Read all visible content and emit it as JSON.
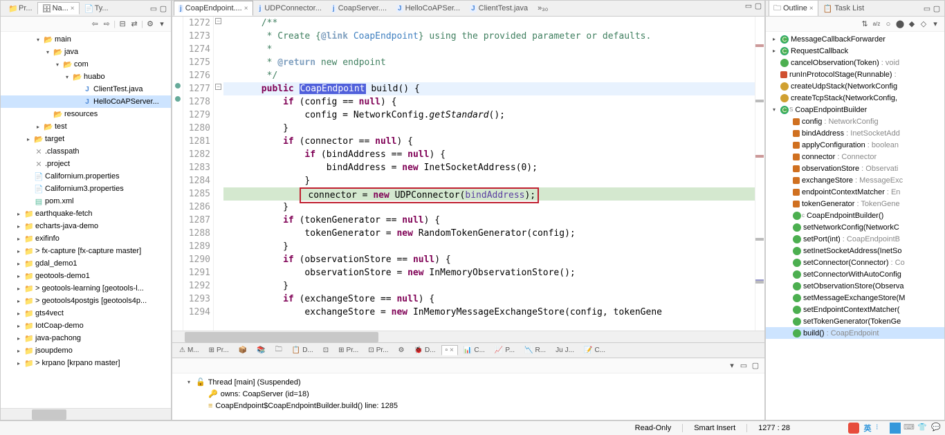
{
  "sidebar": {
    "tabs": [
      {
        "label": "Pr...",
        "active": false
      },
      {
        "label": "Na...",
        "active": true
      },
      {
        "label": "Ty...",
        "active": false
      }
    ],
    "nodes": [
      {
        "indent": 1,
        "arrow": "▾",
        "icon": "folder",
        "label": "main"
      },
      {
        "indent": 2,
        "arrow": "▾",
        "icon": "folder",
        "label": "java"
      },
      {
        "indent": 3,
        "arrow": "▾",
        "icon": "folder",
        "label": "com"
      },
      {
        "indent": 4,
        "arrow": "▾",
        "icon": "pkg",
        "label": "huabo"
      },
      {
        "indent": 5,
        "arrow": "",
        "icon": "java",
        "label": "ClientTest.java"
      },
      {
        "indent": 5,
        "arrow": "",
        "icon": "java",
        "label": "HelloCoAPServer...",
        "selected": true
      },
      {
        "indent": 2,
        "arrow": "",
        "icon": "folder",
        "label": "resources"
      },
      {
        "indent": 1,
        "arrow": "▸",
        "icon": "folder",
        "label": "test"
      },
      {
        "indent": 0,
        "arrow": "▸",
        "icon": "folder",
        "label": "target"
      },
      {
        "indent": 0,
        "arrow": "",
        "icon": "xfile",
        "label": ".classpath"
      },
      {
        "indent": 0,
        "arrow": "",
        "icon": "xfile",
        "label": ".project"
      },
      {
        "indent": 0,
        "arrow": "",
        "icon": "file",
        "label": "Californium.properties"
      },
      {
        "indent": 0,
        "arrow": "",
        "icon": "file",
        "label": "Californium3.properties"
      },
      {
        "indent": 0,
        "arrow": "",
        "icon": "xml",
        "label": "pom.xml"
      },
      {
        "indent": -1,
        "arrow": "▸",
        "icon": "proj",
        "label": "earthquake-fetch"
      },
      {
        "indent": -1,
        "arrow": "▸",
        "icon": "proj",
        "label": "echarts-java-demo"
      },
      {
        "indent": -1,
        "arrow": "▸",
        "icon": "proj",
        "label": "exifinfo"
      },
      {
        "indent": -1,
        "arrow": "▸",
        "icon": "proj",
        "label": "> fx-capture [fx-capture master]"
      },
      {
        "indent": -1,
        "arrow": "▸",
        "icon": "proj",
        "label": "gdal_demo1"
      },
      {
        "indent": -1,
        "arrow": "▸",
        "icon": "proj",
        "label": "geotools-demo1"
      },
      {
        "indent": -1,
        "arrow": "▸",
        "icon": "proj",
        "label": "> geotools-learning [geotools-l..."
      },
      {
        "indent": -1,
        "arrow": "▸",
        "icon": "proj",
        "label": "> geotools4postgis [geotools4p..."
      },
      {
        "indent": -1,
        "arrow": "▸",
        "icon": "proj",
        "label": "gts4vect"
      },
      {
        "indent": -1,
        "arrow": "▸",
        "icon": "proj",
        "label": "IotCoap-demo"
      },
      {
        "indent": -1,
        "arrow": "▸",
        "icon": "proj",
        "label": "java-pachong"
      },
      {
        "indent": -1,
        "arrow": "▸",
        "icon": "proj",
        "label": "jsoupdemo"
      },
      {
        "indent": -1,
        "arrow": "▸",
        "icon": "proj",
        "label": "> krpano [krpano master]"
      }
    ]
  },
  "editor": {
    "tabs": [
      {
        "label": "CoapEndpoint....",
        "icon": "j",
        "active": true
      },
      {
        "label": "UDPConnector...",
        "icon": "j"
      },
      {
        "label": "CoapServer....",
        "icon": "j"
      },
      {
        "label": "HelloCoAPSer...",
        "icon": "J"
      },
      {
        "label": "ClientTest.java",
        "icon": "J"
      }
    ],
    "more": "»₃₀",
    "first_line": 1272,
    "lines": [
      {
        "t": "cm",
        "txt": "       /**"
      },
      {
        "t": "cm",
        "txt": "        * Create {@link CoapEndpoint} using the provided parameter or defaults."
      },
      {
        "t": "cm",
        "txt": "        * "
      },
      {
        "t": "cm",
        "txt": "        * @return new endpoint"
      },
      {
        "t": "cm",
        "txt": "        */"
      },
      {
        "t": "sig",
        "hl": "blue"
      },
      {
        "t": "if1"
      },
      {
        "t": "as1"
      },
      {
        "t": "br",
        "txt": "           }"
      },
      {
        "t": "if2"
      },
      {
        "t": "if3"
      },
      {
        "t": "as2"
      },
      {
        "t": "br",
        "txt": "               }"
      },
      {
        "t": "conn",
        "hl": "green"
      },
      {
        "t": "br",
        "txt": "           }"
      },
      {
        "t": "if4"
      },
      {
        "t": "as3"
      },
      {
        "t": "br",
        "txt": "           }"
      },
      {
        "t": "if5"
      },
      {
        "t": "as4"
      },
      {
        "t": "br",
        "txt": "           }"
      },
      {
        "t": "if6"
      },
      {
        "t": "as5"
      }
    ]
  },
  "outline": {
    "tabs": [
      {
        "label": "Outline",
        "active": true
      },
      {
        "label": "Task List"
      }
    ],
    "items": [
      {
        "ic": "cls",
        "indent": 0,
        "arrow": "▸",
        "label": "MessageCallbackForwarder",
        "type": ""
      },
      {
        "ic": "cls",
        "indent": 0,
        "arrow": "▸",
        "label": "RequestCallback",
        "type": ""
      },
      {
        "ic": "mth",
        "indent": 0,
        "arrow": "",
        "label": "cancelObservation(Token)",
        "type": " : void"
      },
      {
        "ic": "prv",
        "indent": 0,
        "arrow": "",
        "label": "runInProtocolStage(Runnable)",
        "type": " : "
      },
      {
        "ic": "prvm",
        "indent": 0,
        "arrow": "",
        "label": "createUdpStack(NetworkConfig",
        "type": ""
      },
      {
        "ic": "prvm",
        "indent": 0,
        "arrow": "",
        "label": "createTcpStack(NetworkConfig,",
        "type": ""
      },
      {
        "ic": "cls",
        "indent": 0,
        "arrow": "▾",
        "label": "CoapEndpointBuilder",
        "type": "",
        "sup": "S"
      },
      {
        "ic": "fld",
        "indent": 1,
        "arrow": "",
        "label": "config",
        "type": " : NetworkConfig"
      },
      {
        "ic": "fld",
        "indent": 1,
        "arrow": "",
        "label": "bindAddress",
        "type": " : InetSocketAdd"
      },
      {
        "ic": "fld",
        "indent": 1,
        "arrow": "",
        "label": "applyConfiguration",
        "type": " : boolean"
      },
      {
        "ic": "fld",
        "indent": 1,
        "arrow": "",
        "label": "connector",
        "type": " : Connector"
      },
      {
        "ic": "fld",
        "indent": 1,
        "arrow": "",
        "label": "observationStore",
        "type": " : Observati"
      },
      {
        "ic": "fld",
        "indent": 1,
        "arrow": "",
        "label": "exchangeStore",
        "type": " : MessageExc"
      },
      {
        "ic": "fld",
        "indent": 1,
        "arrow": "",
        "label": "endpointContextMatcher",
        "type": " : En"
      },
      {
        "ic": "fld",
        "indent": 1,
        "arrow": "",
        "label": "tokenGenerator",
        "type": " : TokenGene"
      },
      {
        "ic": "ctor",
        "indent": 1,
        "arrow": "",
        "label": "CoapEndpointBuilder()",
        "type": "",
        "sup": "c"
      },
      {
        "ic": "mth",
        "indent": 1,
        "arrow": "",
        "label": "setNetworkConfig(NetworkC",
        "type": ""
      },
      {
        "ic": "mth",
        "indent": 1,
        "arrow": "",
        "label": "setPort(int)",
        "type": " : CoapEndpointB"
      },
      {
        "ic": "mth",
        "indent": 1,
        "arrow": "",
        "label": "setInetSocketAddress(InetSo",
        "type": ""
      },
      {
        "ic": "mth",
        "indent": 1,
        "arrow": "",
        "label": "setConnector(Connector)",
        "type": " : Co"
      },
      {
        "ic": "mth",
        "indent": 1,
        "arrow": "",
        "label": "setConnectorWithAutoConfig",
        "type": ""
      },
      {
        "ic": "mth",
        "indent": 1,
        "arrow": "",
        "label": "setObservationStore(Observa",
        "type": ""
      },
      {
        "ic": "mth",
        "indent": 1,
        "arrow": "",
        "label": "setMessageExchangeStore(M",
        "type": ""
      },
      {
        "ic": "mth",
        "indent": 1,
        "arrow": "",
        "label": "setEndpointContextMatcher(",
        "type": ""
      },
      {
        "ic": "mth",
        "indent": 1,
        "arrow": "",
        "label": "setTokenGenerator(TokenGe",
        "type": ""
      },
      {
        "ic": "mth",
        "indent": 1,
        "arrow": "",
        "label": "build()",
        "type": " : CoapEndpoint",
        "sel": true
      }
    ]
  },
  "debug": {
    "tabs": [
      "M...",
      "Pr...",
      "",
      "",
      "",
      "D...",
      "",
      "Pr...",
      "Pr...",
      "",
      "D...",
      "",
      "C...",
      "P...",
      "R...",
      "J...",
      "C..."
    ],
    "active_tab_idx": 11,
    "rows": [
      {
        "icon": "thread",
        "label": "Thread [main] (Suspended)",
        "arrow": "▾",
        "indent": 0
      },
      {
        "icon": "own",
        "label": "owns: CoapServer  (id=18)",
        "indent": 1
      },
      {
        "icon": "frame",
        "label": "CoapEndpoint$CoapEndpointBuilder.build() line: 1285",
        "indent": 1
      }
    ]
  },
  "status": {
    "readonly": "Read-Only",
    "insert": "Smart Insert",
    "pos": "1277 : 28"
  },
  "ime": "英"
}
